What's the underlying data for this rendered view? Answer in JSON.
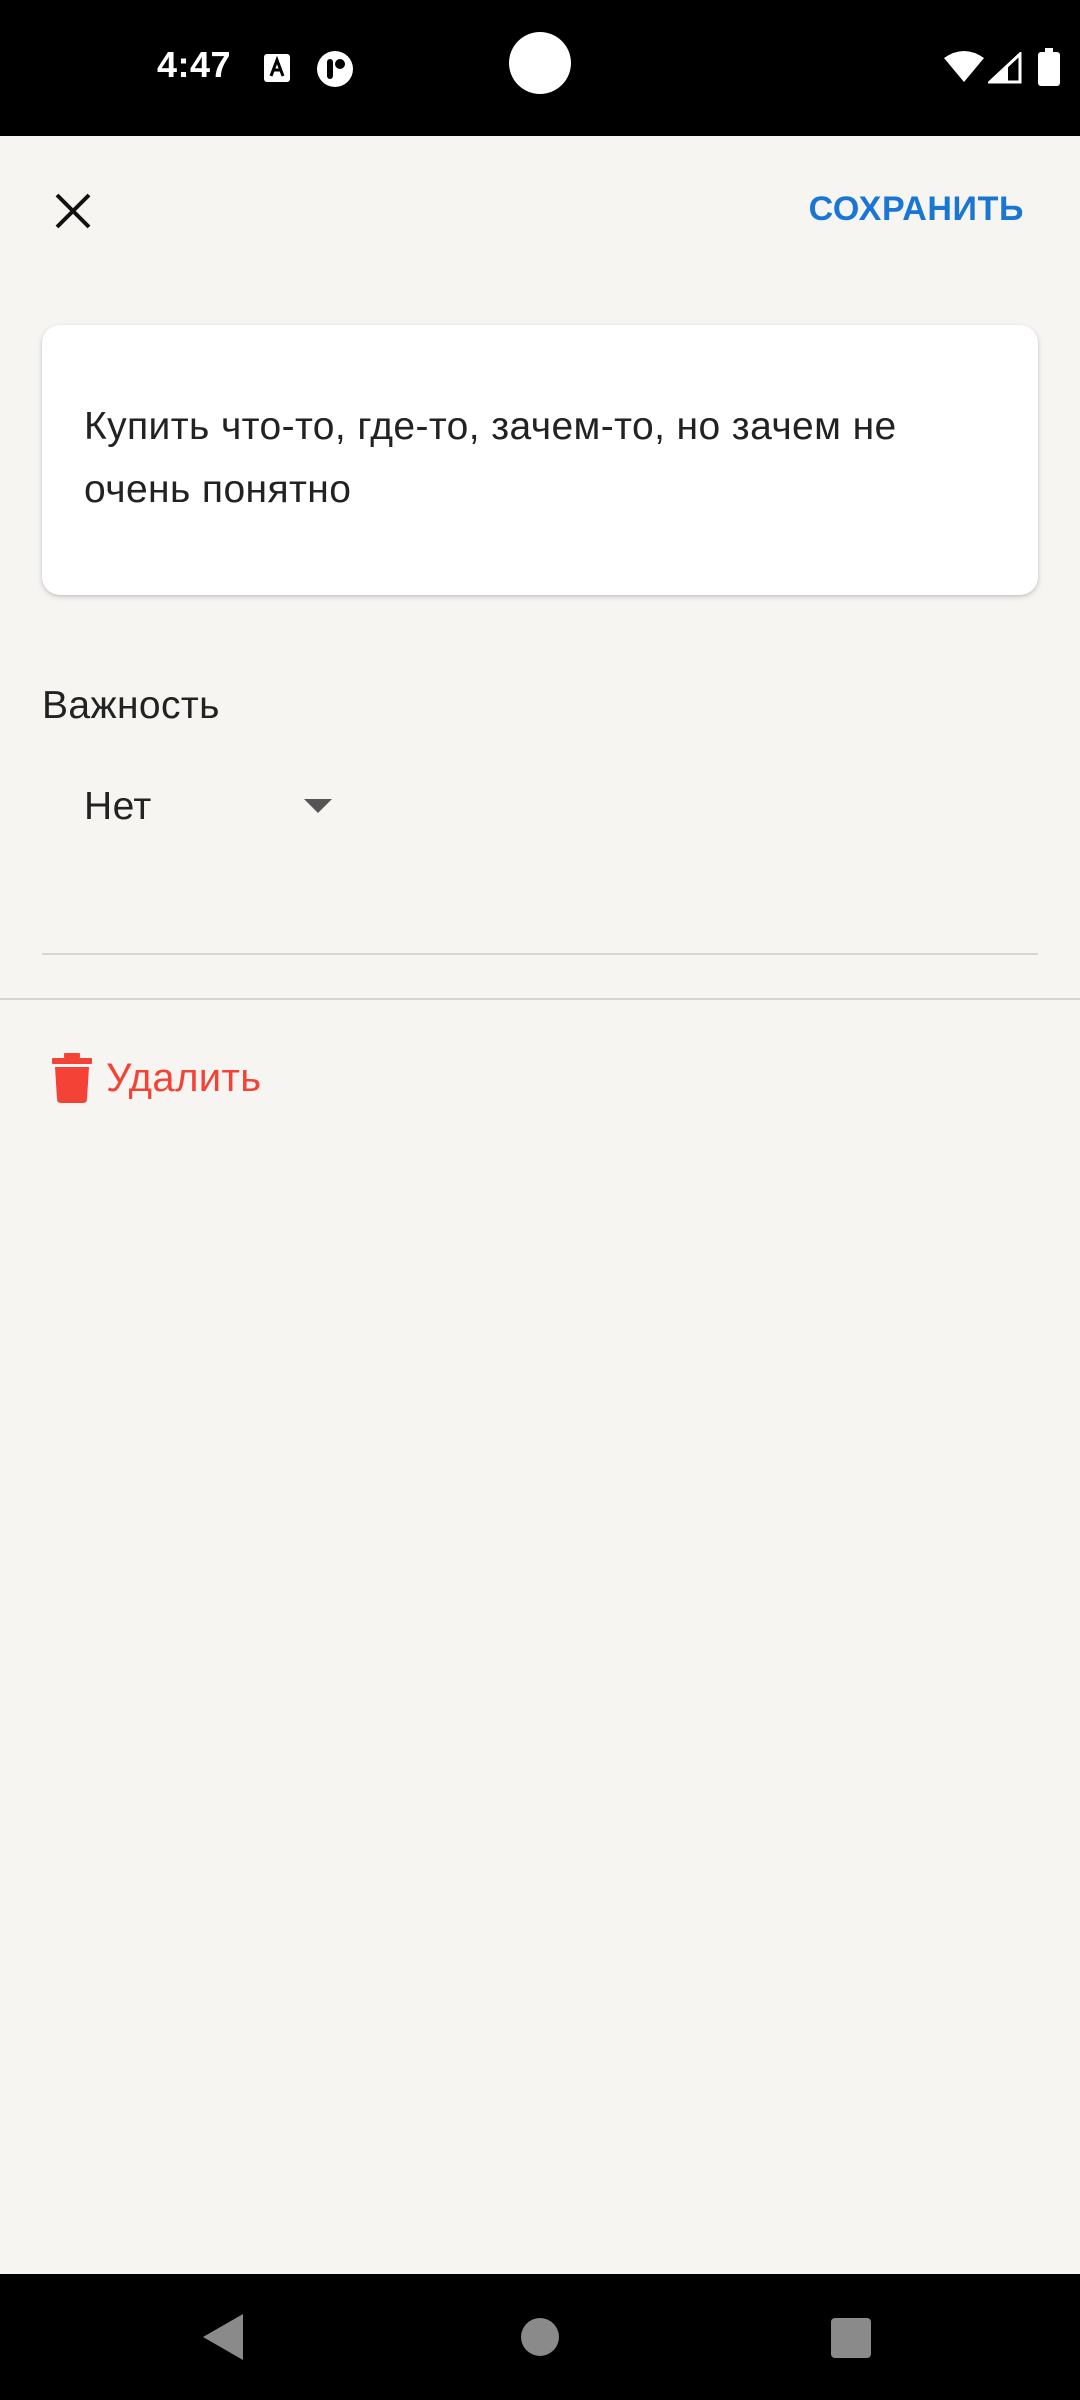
{
  "status_bar": {
    "time": "4:47",
    "icons": [
      "a-notification-icon",
      "t-notification-icon",
      "wifi-icon",
      "signal-icon",
      "battery-icon"
    ]
  },
  "toolbar": {
    "close_icon": "close-icon",
    "save_label": "СОХРАНИТЬ"
  },
  "task": {
    "text": "Купить что-то, где-то, зачем-то, но зачем не очень понятно"
  },
  "importance": {
    "label": "Важность",
    "selected": "Нет"
  },
  "delete": {
    "icon": "trash-icon",
    "label": "Удалить"
  },
  "nav_bar": {
    "icons": [
      "back-icon",
      "home-icon",
      "recents-icon"
    ]
  },
  "colors": {
    "accent": "#1976d2",
    "danger": "#f44336",
    "background": "#f6f5f2",
    "card": "#ffffff",
    "text": "#222222"
  }
}
